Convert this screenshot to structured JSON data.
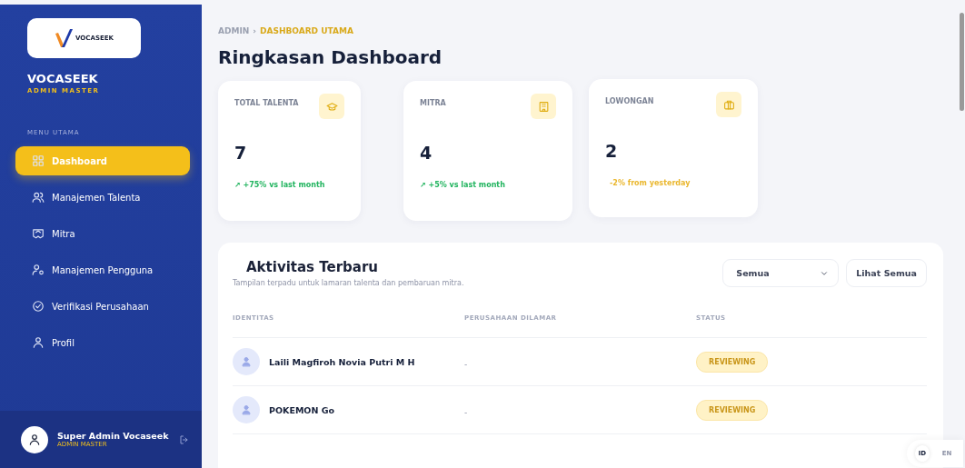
{
  "sidebar": {
    "logo_text": "VOCASEEK",
    "brand": "VOCASEEK",
    "role": "ADMIN MASTER",
    "section_label": "MENU UTAMA",
    "items": [
      {
        "label": "Dashboard",
        "selected": true
      },
      {
        "label": "Manajemen Talenta",
        "selected": false
      },
      {
        "label": "Mitra",
        "selected": false
      },
      {
        "label": "Manajemen Pengguna",
        "selected": false
      },
      {
        "label": "Verifikasi Perusahaan",
        "selected": false
      },
      {
        "label": "Profil",
        "selected": false
      }
    ],
    "user": {
      "name": "Super Admin Vocaseek",
      "role": "ADMIN MASTER"
    }
  },
  "breadcrumb": {
    "separator": "›",
    "items": [
      {
        "label": "ADMIN",
        "selected": false
      },
      {
        "label": "DASHBOARD UTAMA",
        "selected": true
      }
    ]
  },
  "page_title": "Ringkasan Dashboard",
  "stats": [
    {
      "label": "TOTAL TALENTA",
      "value": "7",
      "trend": "↗ +75% vs last month",
      "kind": "up"
    },
    {
      "label": "MITRA",
      "value": "4",
      "trend": "↗ +5% vs last month",
      "kind": "up"
    },
    {
      "label": "LOWONGAN",
      "value": "2",
      "trend": "-2% from yesterday",
      "kind": "warn"
    }
  ],
  "activity": {
    "title": "Aktivitas Terbaru",
    "subtitle": "Tampilan terpadu untuk lamaran talenta dan pembaruan mitra.",
    "filter": {
      "value": "Semua"
    },
    "button": "Lihat Semua",
    "columns": [
      "IDENTITAS",
      "PERUSAHAAN DILAMAR",
      "STATUS"
    ],
    "rows": [
      {
        "name": "Laili Magfiroh Novia Putri M H",
        "company": "-",
        "status": "REVIEWING"
      },
      {
        "name": "POKEMON Go",
        "company": "-",
        "status": "REVIEWING"
      }
    ]
  },
  "language": [
    {
      "label": "ID",
      "selected": true
    },
    {
      "label": "EN",
      "selected": false
    }
  ]
}
